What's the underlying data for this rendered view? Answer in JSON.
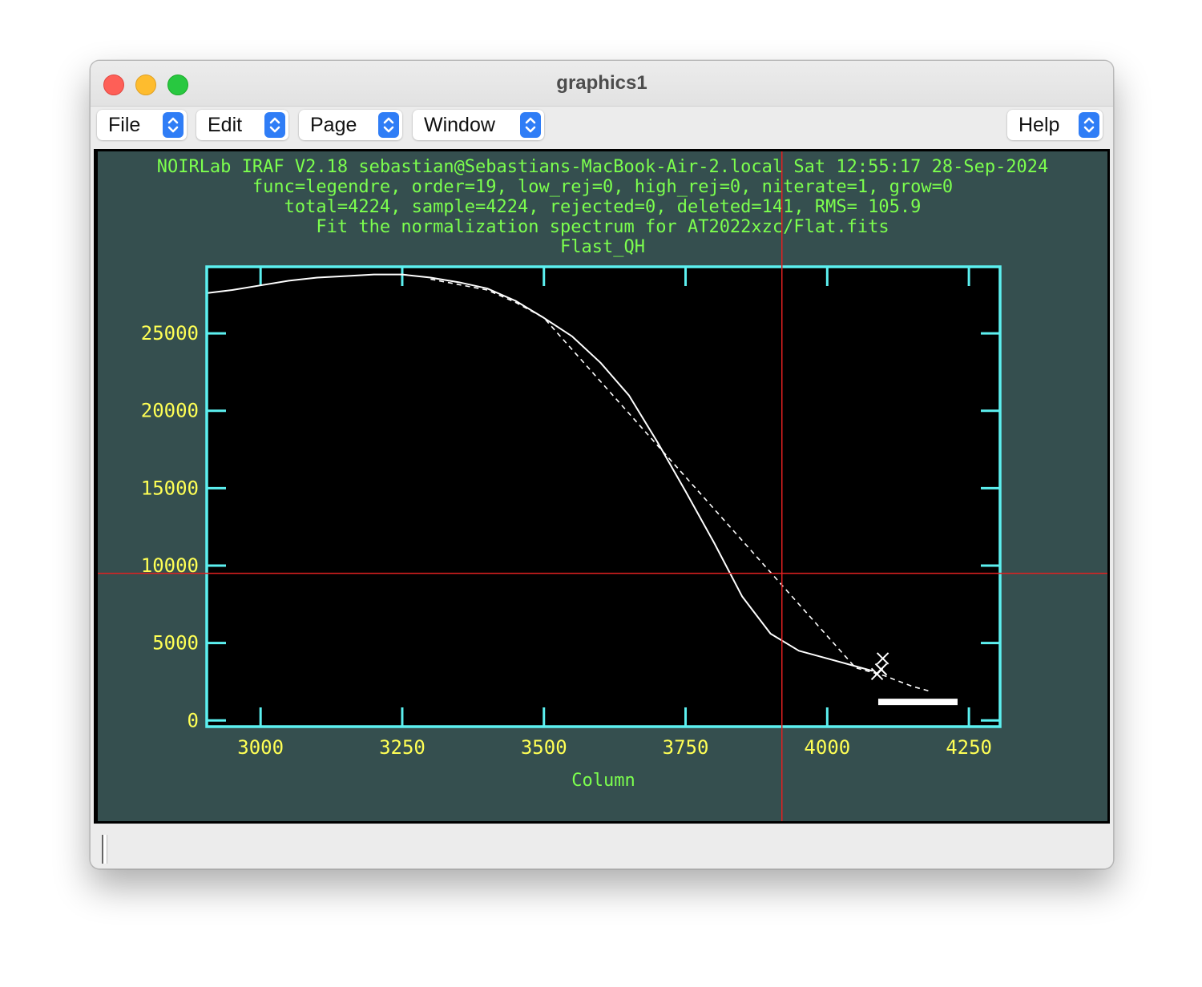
{
  "window": {
    "title": "graphics1"
  },
  "menus": {
    "file": "File",
    "edit": "Edit",
    "page": "Page",
    "window": "Window",
    "help": "Help"
  },
  "plot": {
    "header_lines": [
      "NOIRLab IRAF V2.18 sebastian@Sebastians-MacBook-Air-2.local Sat 12:55:17 28-Sep-2024",
      "func=legendre, order=19, low_rej=0, high_rej=0, niterate=1, grow=0",
      "total=4224, sample=4224, rejected=0, deleted=141, RMS=  105.9",
      "Fit the normalization spectrum for AT2022xzc/Flat.fits",
      "Flast_QH"
    ],
    "colors": {
      "background": "#354f4f",
      "axes": "#5cf0f0",
      "tick_labels": "#ffff55",
      "header": "#7cff4e",
      "data": "#ffffff",
      "cursor": "#e02020"
    }
  },
  "chart_data": {
    "type": "line",
    "xlabel": "Column",
    "ylabel": "",
    "xlim": [
      2905,
      4305
    ],
    "ylim": [
      -400,
      29300
    ],
    "xticks": [
      3000,
      3250,
      3500,
      3750,
      4000,
      4250
    ],
    "yticks": [
      0,
      5000,
      10000,
      15000,
      20000,
      25000
    ],
    "series": [
      {
        "x": [
          2905,
          2950,
          3000,
          3050,
          3100,
          3150,
          3200,
          3250,
          3300,
          3350,
          3400,
          3450,
          3500,
          3550,
          3600,
          3650,
          3700,
          3750,
          3800,
          3850,
          3900,
          3950,
          4000,
          4050,
          4080
        ],
        "y": [
          27600,
          27800,
          28100,
          28400,
          28600,
          28700,
          28800,
          28800,
          28600,
          28300,
          27900,
          27100,
          26000,
          24800,
          23100,
          21000,
          18000,
          14800,
          11500,
          8000,
          5600,
          4500,
          4000,
          3500,
          3200
        ]
      },
      {
        "x": [
          3300,
          3400,
          3450,
          3500,
          4050,
          4100,
          4150,
          4180
        ],
        "y": [
          28500,
          27800,
          27000,
          26000,
          3400,
          2900,
          2200,
          1900
        ]
      },
      {
        "x": [
          4090,
          4110,
          4130,
          4150,
          4170,
          4190,
          4210,
          4230
        ],
        "y": [
          1200,
          1200,
          1200,
          1200,
          1200,
          1200,
          1200,
          1200
        ]
      }
    ],
    "cursor": {
      "x": 3920,
      "y": 9500
    }
  }
}
